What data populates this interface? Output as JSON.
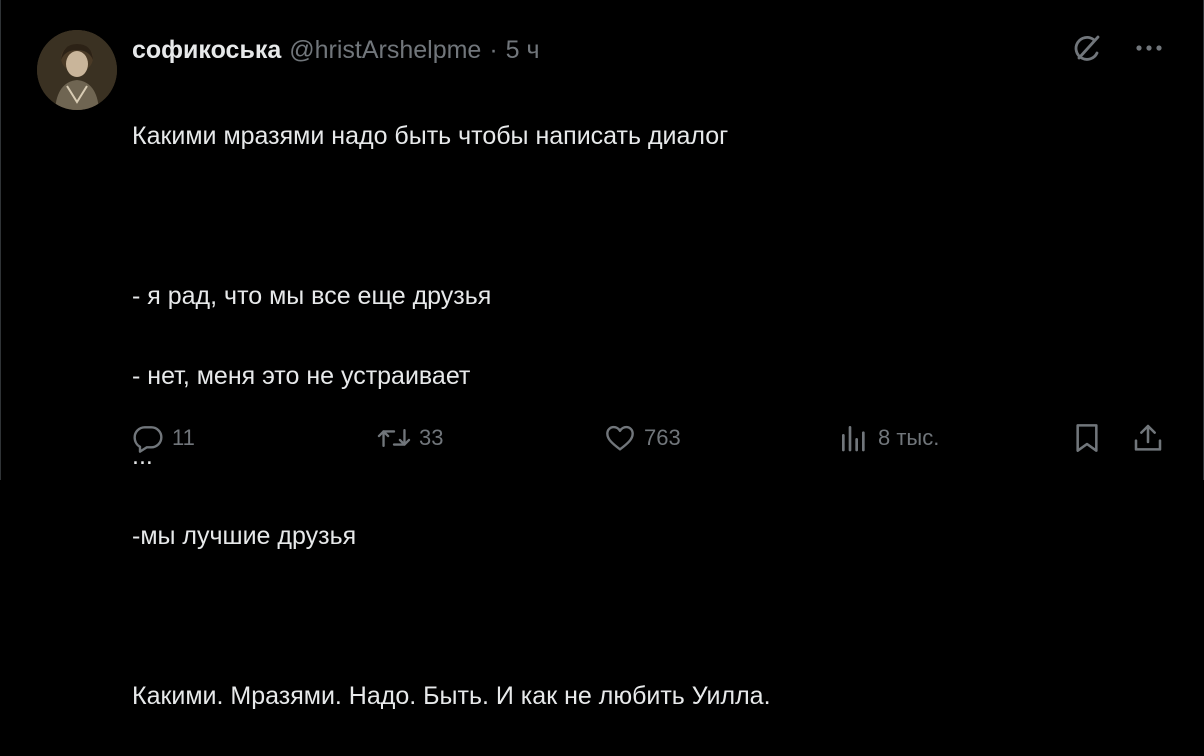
{
  "tweet": {
    "author": {
      "display_name": "софикоська",
      "handle": "@hristArshelpme",
      "separator": "·",
      "time": "5 ч"
    },
    "text_lines": [
      "Какими мразями надо быть чтобы написать диалог",
      "",
      "- я рад, что мы все еще друзья",
      "- нет, меня это не устраивает",
      "...",
      "-мы лучшие друзья",
      "",
      "Какими. Мразями. Надо. Быть. И как не любить Уилла."
    ],
    "actions": {
      "replies": "11",
      "reposts": "33",
      "likes": "763",
      "views": "8 тыс."
    }
  },
  "icons": {
    "grok": "grok-icon",
    "more": "more-icon",
    "reply": "reply-icon",
    "repost": "repost-icon",
    "like": "heart-icon",
    "views": "views-icon",
    "bookmark": "bookmark-icon",
    "share": "share-icon"
  },
  "colors": {
    "background": "#000000",
    "text_primary": "#e7e9ea",
    "text_secondary": "#71767b"
  }
}
